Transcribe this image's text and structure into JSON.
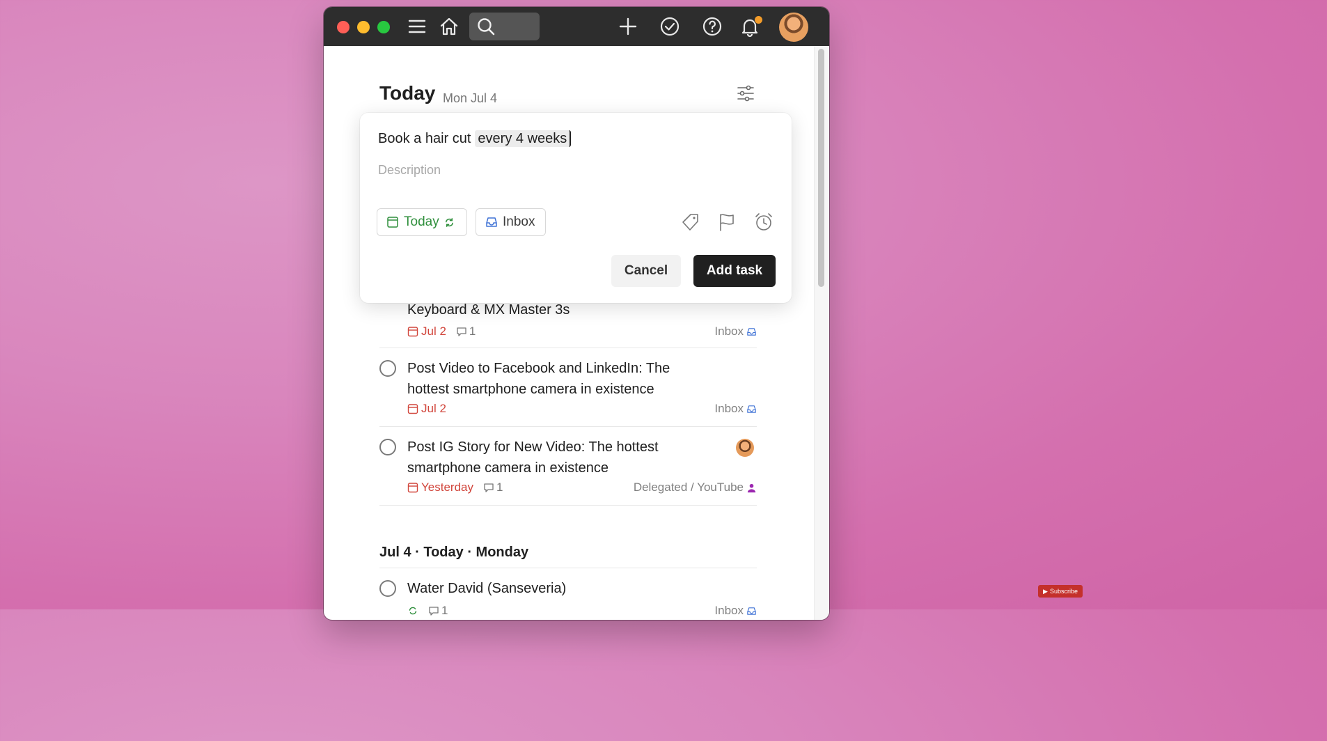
{
  "header": {
    "title": "Today",
    "date": "Mon Jul 4"
  },
  "quick_add": {
    "task_text": "Book a hair cut",
    "recurrence_text": "every 4 weeks",
    "description_placeholder": "Description",
    "due_chip": "Today",
    "project_chip": "Inbox",
    "cancel_label": "Cancel",
    "submit_label": "Add task"
  },
  "tasks": [
    {
      "title": "Keyboard & MX Master 3s",
      "date": "Jul 2",
      "comments": "1",
      "project": "Inbox"
    },
    {
      "title": "Post Video to Facebook and LinkedIn: The hottest smartphone camera in existence",
      "date": "Jul 2",
      "project": "Inbox"
    },
    {
      "title": "Post IG Story for New Video: The hottest smartphone camera in existence",
      "date": "Yesterday",
      "comments": "1",
      "project": "Delegated / YouTube"
    }
  ],
  "section": {
    "heading": "Jul 4 · Today · Monday",
    "tasks": [
      {
        "title": "Water David (Sanseveria)",
        "comments": "1",
        "project": "Inbox"
      }
    ]
  },
  "colors": {
    "accent_green": "#2f8f3c",
    "overdue_red": "#d1453b",
    "dark": "#202020"
  },
  "overlay": {
    "subscribe_label": "Subscribe"
  }
}
